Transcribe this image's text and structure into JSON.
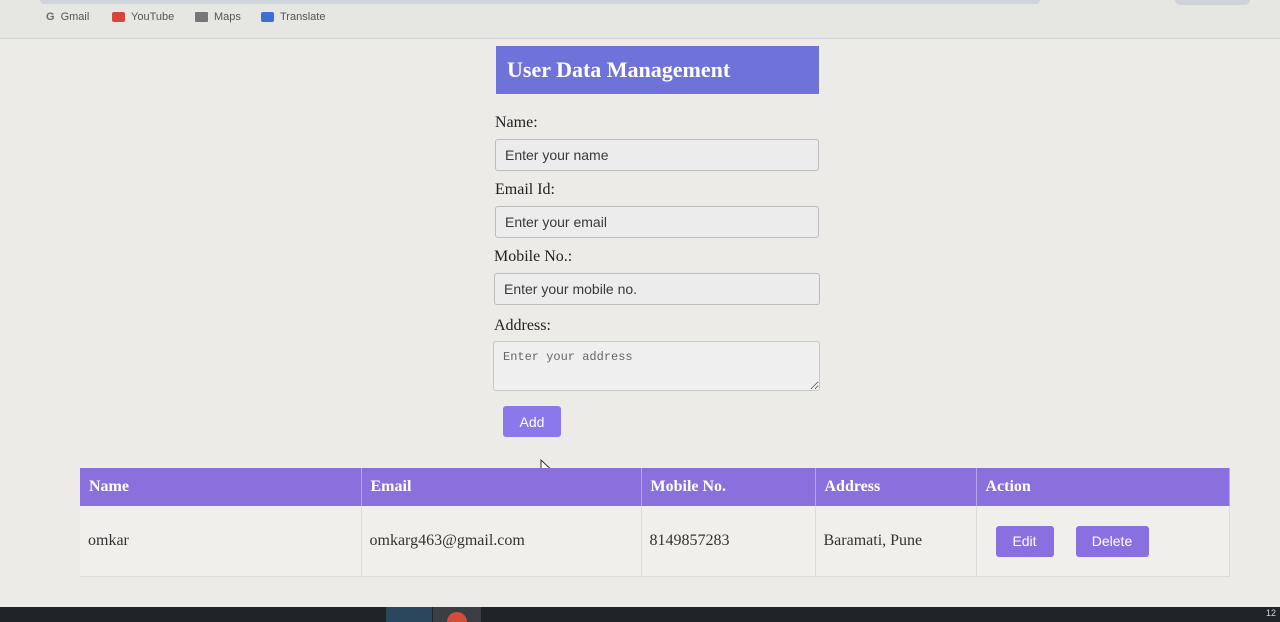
{
  "bookmarks": [
    {
      "label": "Gmail",
      "icon": "google-g-icon"
    },
    {
      "label": "YouTube",
      "icon": "youtube-icon"
    },
    {
      "label": "Maps",
      "icon": "maps-icon"
    },
    {
      "label": "Translate",
      "icon": "translate-icon"
    }
  ],
  "page": {
    "title": "User Data Management",
    "accent_color": "#6f72d8",
    "button_color": "#8b78ea"
  },
  "form": {
    "name_label": "Name:",
    "name_placeholder": "Enter your name",
    "email_label": "Email Id:",
    "email_placeholder": "Enter your email",
    "mobile_label": "Mobile No.:",
    "mobile_placeholder": "Enter your mobile no.",
    "address_label": "Address:",
    "address_placeholder": "Enter your address",
    "add_label": "Add"
  },
  "table": {
    "headers": [
      "Name",
      "Email",
      "Mobile No.",
      "Address",
      "Action"
    ],
    "rows": [
      {
        "name": "omkar",
        "email": "omkarg463@gmail.com",
        "mobile": "8149857283",
        "address": "Baramati, Pune",
        "edit_label": "Edit",
        "delete_label": "Delete"
      }
    ]
  },
  "taskbar": {
    "clock": "12"
  }
}
